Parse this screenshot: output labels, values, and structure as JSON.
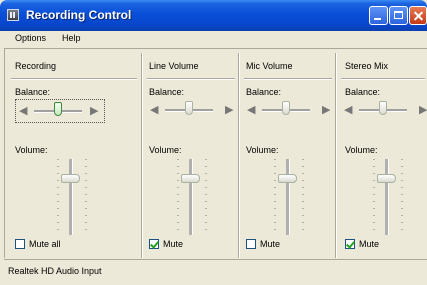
{
  "window": {
    "title": "Recording Control"
  },
  "menu": [
    {
      "label": "Options"
    },
    {
      "label": "Help"
    }
  ],
  "columns": [
    {
      "title": "Recording",
      "balance_label": "Balance:",
      "volume_label": "Volume:",
      "balance": 0.5,
      "volume": 0.75,
      "checkbox_label": "Mute all",
      "checked": false,
      "focused": true
    },
    {
      "title": "Line Volume",
      "balance_label": "Balance:",
      "volume_label": "Volume:",
      "balance": 0.5,
      "volume": 0.75,
      "checkbox_label": "Mute",
      "checked": true,
      "focused": false
    },
    {
      "title": "Mic Volume",
      "balance_label": "Balance:",
      "volume_label": "Volume:",
      "balance": 0.5,
      "volume": 0.75,
      "checkbox_label": "Mute",
      "checked": false,
      "focused": false
    },
    {
      "title": "Stereo Mix",
      "balance_label": "Balance:",
      "volume_label": "Volume:",
      "balance": 0.5,
      "volume": 0.75,
      "checkbox_label": "Mute",
      "checked": true,
      "focused": false
    }
  ],
  "status": {
    "text": "Realtek HD Audio Input"
  },
  "icons": {
    "app": "speaker-app-icon",
    "balance_left": "speaker-left-icon",
    "balance_right": "speaker-right-icon"
  },
  "colors": {
    "titlebar": "#0a4fd8",
    "window_bg": "#ece9d8",
    "check": "#21a121",
    "close_button": "#c63a16"
  }
}
